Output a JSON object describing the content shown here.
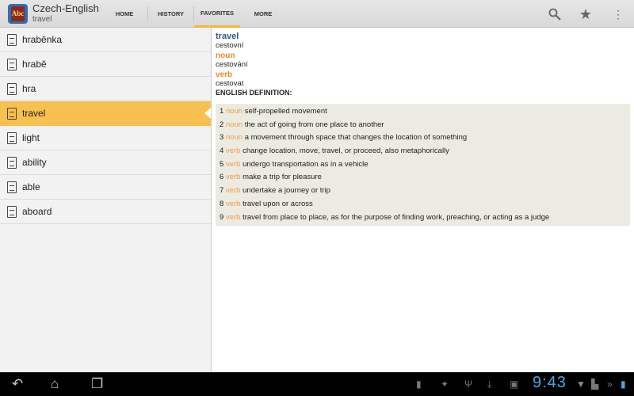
{
  "app": {
    "title": "Czech-English",
    "subtitle": "travel",
    "icon": "dictionary-book-icon"
  },
  "tabs": [
    {
      "label": "HOME"
    },
    {
      "label": "HISTORY"
    },
    {
      "label": "FAVORITES",
      "selected": true
    },
    {
      "label": "MORE"
    }
  ],
  "actions": [
    "search-icon",
    "star-icon",
    "overflow-menu-icon"
  ],
  "list": [
    {
      "label": "hraběnka"
    },
    {
      "label": "hrabě"
    },
    {
      "label": "hra"
    },
    {
      "label": "travel",
      "selected": true
    },
    {
      "label": "light"
    },
    {
      "label": "ability"
    },
    {
      "label": "able"
    },
    {
      "label": "aboard"
    }
  ],
  "entry": {
    "headword": "travel",
    "translation": "cestovní",
    "pos1": "noun",
    "pos1_translation": "cestování",
    "pos2": "verb",
    "pos2_translation": "cestovat",
    "definition_heading": "ENGLISH DEFINITION:",
    "definitions": [
      {
        "n": "1",
        "pos": "noun",
        "text": "self-propelled movement"
      },
      {
        "n": "2",
        "pos": "noun",
        "text": "the act of going from one place to another"
      },
      {
        "n": "3",
        "pos": "noun",
        "text": "a movement through space that changes the location of something"
      },
      {
        "n": "4",
        "pos": "verb",
        "text": "change location, move, travel, or proceed, also metaphorically"
      },
      {
        "n": "5",
        "pos": "verb",
        "text": "undergo transportation as in a vehicle"
      },
      {
        "n": "6",
        "pos": "verb",
        "text": "make a trip for pleasure"
      },
      {
        "n": "7",
        "pos": "verb",
        "text": "undertake a journey or trip"
      },
      {
        "n": "8",
        "pos": "verb",
        "text": "travel upon or across"
      },
      {
        "n": "9",
        "pos": "verb",
        "text": "travel from place to place, as for the purpose of finding work, preaching, or acting as a judge"
      }
    ]
  },
  "status": {
    "time": "9:43"
  },
  "colors": {
    "accent": "#f8c04f",
    "headword": "#2d5a8e",
    "pos": "#f08a24",
    "clock": "#4aa7e6"
  }
}
